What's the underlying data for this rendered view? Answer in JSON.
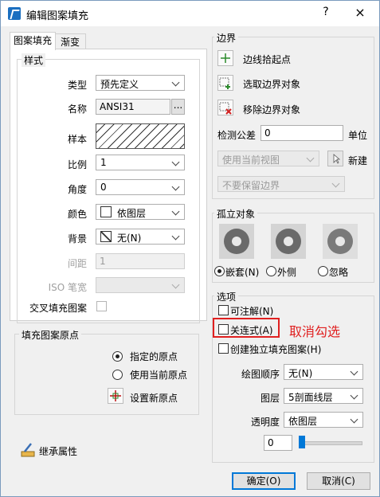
{
  "window": {
    "title": "编辑图案填充",
    "help": "?",
    "close": "×"
  },
  "tabs": [
    "图案填充",
    "渐变"
  ],
  "style_group": {
    "title": "样式",
    "type_label": "类型",
    "type_value": "预先定义",
    "name_label": "名称",
    "name_value": "ANSI31",
    "browse": "...",
    "sample_label": "样本",
    "scale_label": "比例",
    "scale_value": "1",
    "angle_label": "角度",
    "angle_value": "0",
    "color_label": "颜色",
    "color_value": "依图层",
    "bg_label": "背景",
    "bg_value": "无(N)",
    "spacing_label": "间距",
    "spacing_value": "1",
    "iso_label": "ISO 笔宽",
    "cross_label": "交叉填充图案"
  },
  "origin_group": {
    "title": "填充图案原点",
    "specified": "指定的原点",
    "current": "使用当前原点",
    "set_new": "设置新原点"
  },
  "inherit_label": "继承属性",
  "boundary_group": {
    "title": "边界",
    "pick_points": "边线拾起点",
    "select_objects": "选取边界对象",
    "remove": "移除边界对象",
    "tolerance_label": "检测公差",
    "tolerance_value": "0",
    "unit": "单位",
    "view_value": "使用当前视图",
    "new": "新建",
    "keep_value": "不要保留边界"
  },
  "island_group": {
    "title": "孤立对象",
    "nested": "嵌套(N)",
    "outer": "外侧",
    "ignore": "忽略"
  },
  "options_group": {
    "title": "选项",
    "annotative": "可注解(N)",
    "associative": "关连式(A)",
    "separate": "创建独立填充图案(H)",
    "draw_order_label": "绘图顺序",
    "draw_order_value": "无(N)",
    "layer_label": "图层",
    "layer_value": "5剖面线层",
    "transparency_label": "透明度",
    "transparency_value": "依图层",
    "transparency_number": "0"
  },
  "annotation": "取消勾选",
  "buttons": {
    "ok": "确定(O)",
    "cancel": "取消(C)"
  },
  "colors": {
    "accent": "#0078d7",
    "highlight": "#e02020",
    "title_icon": "#1b6fc0"
  }
}
